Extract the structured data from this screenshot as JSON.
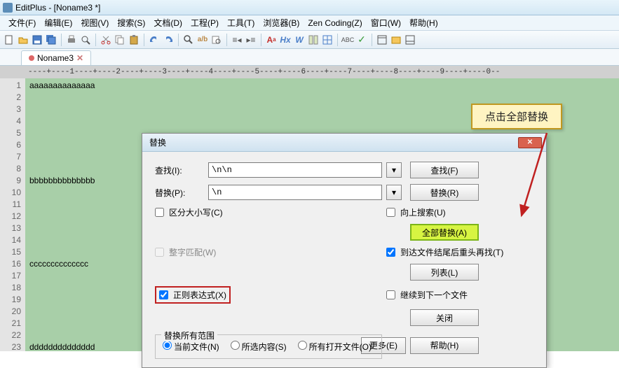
{
  "window": {
    "title": "EditPlus - [Noname3 *]"
  },
  "menu": {
    "file": "文件(F)",
    "edit": "编辑(E)",
    "view": "视图(V)",
    "search": "搜索(S)",
    "document": "文档(D)",
    "project": "工程(P)",
    "tool": "工具(T)",
    "browser": "浏览器(B)",
    "zen": "Zen Coding(Z)",
    "window": "窗口(W)",
    "help": "帮助(H)"
  },
  "tab": {
    "name": "Noname3"
  },
  "ruler": "----+----1----+----2----+----3----+----4----+----5----+----6----+----7----+----8----+----9----+----0--",
  "lines": {
    "l1": "aaaaaaaaaaaaaa",
    "l9": "bbbbbbbbbbbbbb",
    "l16": "cccccccccccccc",
    "l23": "dddddddddddddd"
  },
  "dialog": {
    "title": "替换",
    "find_label": "查找(I):",
    "find_value": "\\n\\n",
    "replace_label": "替换(P):",
    "replace_value": "\\n",
    "case": "区分大小写(C)",
    "whole": "整字匹配(W)",
    "regex": "正则表达式(X)",
    "upward": "向上搜索(U)",
    "wrap": "到达文件结尾后重头再找(T)",
    "continue": "继续到下一个文件",
    "scope_title": "替换所有范围",
    "scope_current": "当前文件(N)",
    "scope_selection": "所选内容(S)",
    "scope_allopen": "所有打开文件(O)",
    "btn_find": "查找(F)",
    "btn_replace": "替换(R)",
    "btn_replace_all": "全部替换(A)",
    "btn_list": "列表(L)",
    "btn_close": "关闭",
    "btn_more": "更多(E)",
    "btn_help": "帮助(H)"
  },
  "annotation": "点击全部替换",
  "gutter": [
    "1",
    "2",
    "3",
    "4",
    "5",
    "6",
    "7",
    "8",
    "9",
    "10",
    "11",
    "12",
    "13",
    "14",
    "15",
    "16",
    "17",
    "18",
    "19",
    "20",
    "21",
    "22",
    "23"
  ]
}
